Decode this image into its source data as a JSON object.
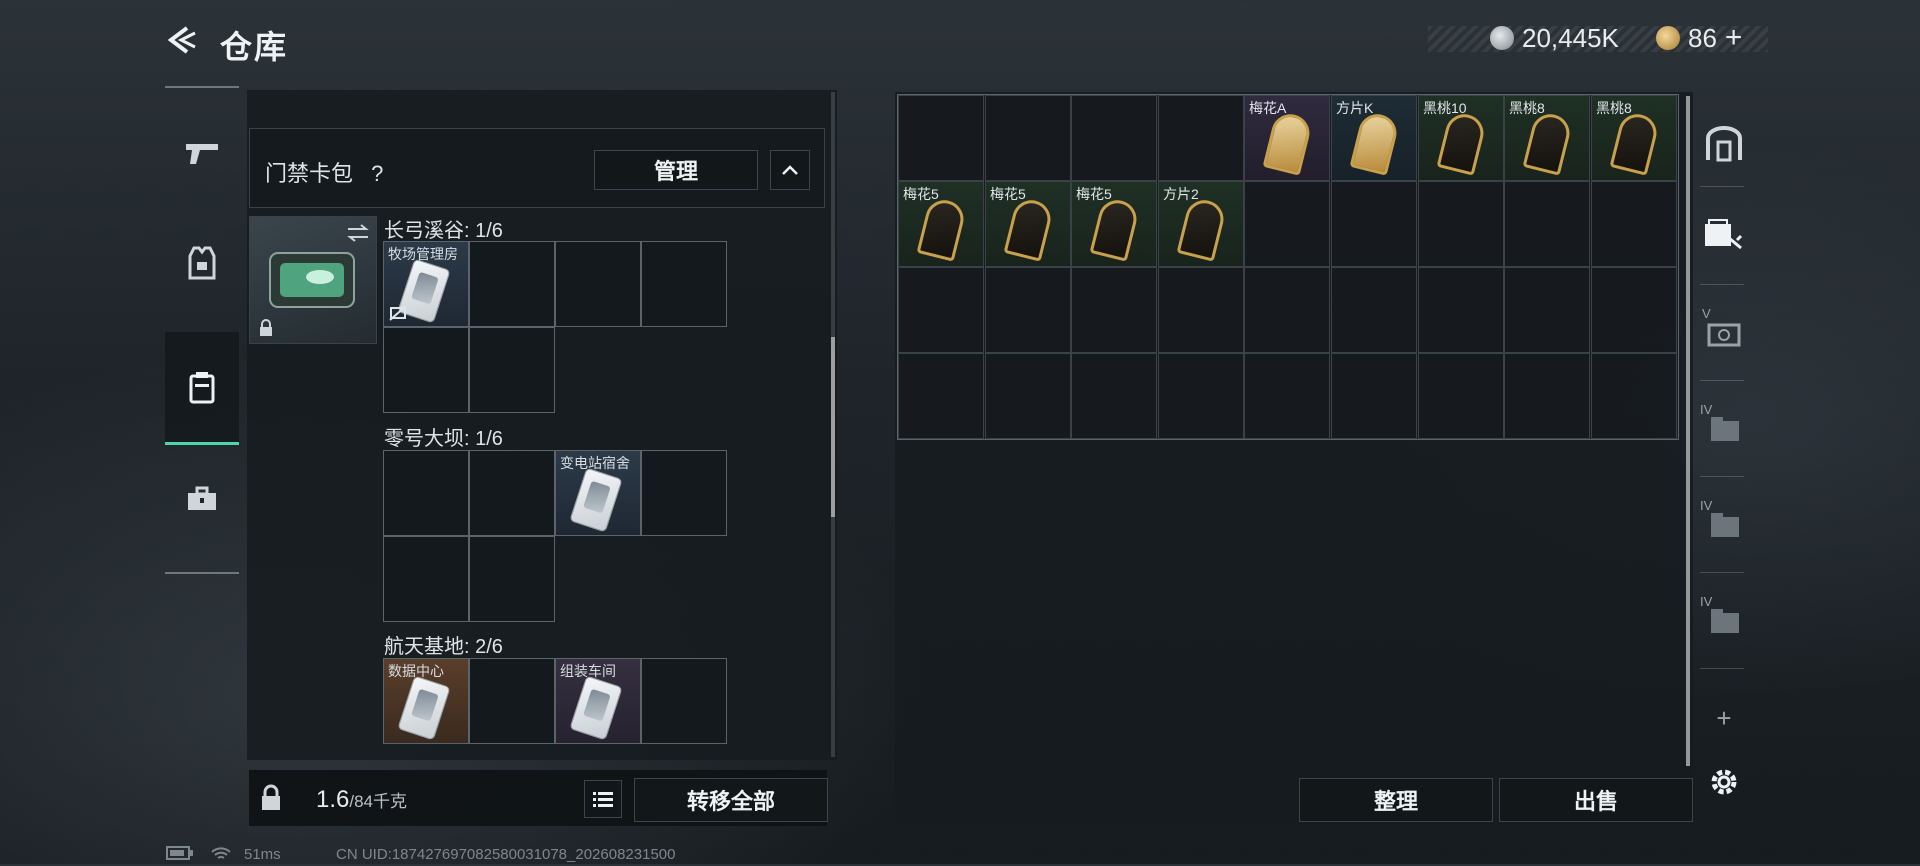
{
  "header": {
    "title": "仓库",
    "back_label": "",
    "currency_main": "20,445K",
    "currency_premium": "86",
    "add_label": "+"
  },
  "left_rail": {
    "tabs": [
      {
        "id": "weapons",
        "icon": "gun-icon",
        "active": false
      },
      {
        "id": "armor",
        "icon": "vest-icon",
        "active": false
      },
      {
        "id": "keycards",
        "icon": "keycard-case-icon",
        "active": true
      },
      {
        "id": "toolbox",
        "icon": "toolbox-icon",
        "active": false
      }
    ]
  },
  "cardbag": {
    "title": "门禁卡包",
    "help": "?",
    "manage_label": "管理"
  },
  "maps": [
    {
      "label": "长弓溪谷: 1/6",
      "slots": [
        {
          "name": "牧场管理房",
          "filled": true,
          "color": "blue"
        },
        {
          "name": "",
          "filled": false
        },
        {
          "name": "",
          "filled": false
        },
        {
          "name": "",
          "filled": false
        },
        {
          "name": "",
          "filled": false
        },
        {
          "name": "",
          "filled": false
        }
      ]
    },
    {
      "label": "零号大坝: 1/6",
      "slots": [
        {
          "name": "",
          "filled": false
        },
        {
          "name": "",
          "filled": false
        },
        {
          "name": "变电站宿舍",
          "filled": true,
          "color": "blue"
        },
        {
          "name": "",
          "filled": false
        },
        {
          "name": "",
          "filled": false
        },
        {
          "name": "",
          "filled": false
        }
      ]
    },
    {
      "label": "航天基地: 2/6",
      "slots": [
        {
          "name": "数据中心",
          "filled": true,
          "color": "orange"
        },
        {
          "name": "",
          "filled": false
        },
        {
          "name": "组装车间",
          "filled": true,
          "color": "purple"
        },
        {
          "name": "",
          "filled": false
        }
      ]
    }
  ],
  "bottom": {
    "weight_current": "1.6",
    "weight_max": "/84千克",
    "transfer_all_label": "转移全部"
  },
  "inventory": {
    "row1": [
      {
        "name": "",
        "kind": "empty"
      },
      {
        "name": "",
        "kind": "empty"
      },
      {
        "name": "",
        "kind": "empty"
      },
      {
        "name": "",
        "kind": "empty"
      },
      {
        "name": "梅花A",
        "kind": "purple"
      },
      {
        "name": "方片K",
        "kind": "diamond"
      },
      {
        "name": "黑桃10",
        "kind": "spade"
      },
      {
        "name": "黑桃8",
        "kind": "spade"
      },
      {
        "name": "黑桃8",
        "kind": "spade"
      }
    ],
    "row2": [
      {
        "name": "梅花5",
        "kind": "club"
      },
      {
        "name": "梅花5",
        "kind": "club"
      },
      {
        "name": "梅花5",
        "kind": "club"
      },
      {
        "name": "方片2",
        "kind": "club"
      }
    ],
    "sort_label": "整理",
    "sell_label": "出售"
  },
  "right_rail": {
    "items": [
      "safe-box-icon",
      "keycard-box-icon",
      "level-v-icon",
      "level-iv-icon",
      "level-iv-icon",
      "level-iv-icon"
    ],
    "level_labels": [
      "V",
      "IV",
      "IV",
      "IV"
    ],
    "add_label": "+"
  },
  "status_bar": {
    "ping": "51ms",
    "uid": "CN UID:187427697082580031078_202608231500"
  }
}
